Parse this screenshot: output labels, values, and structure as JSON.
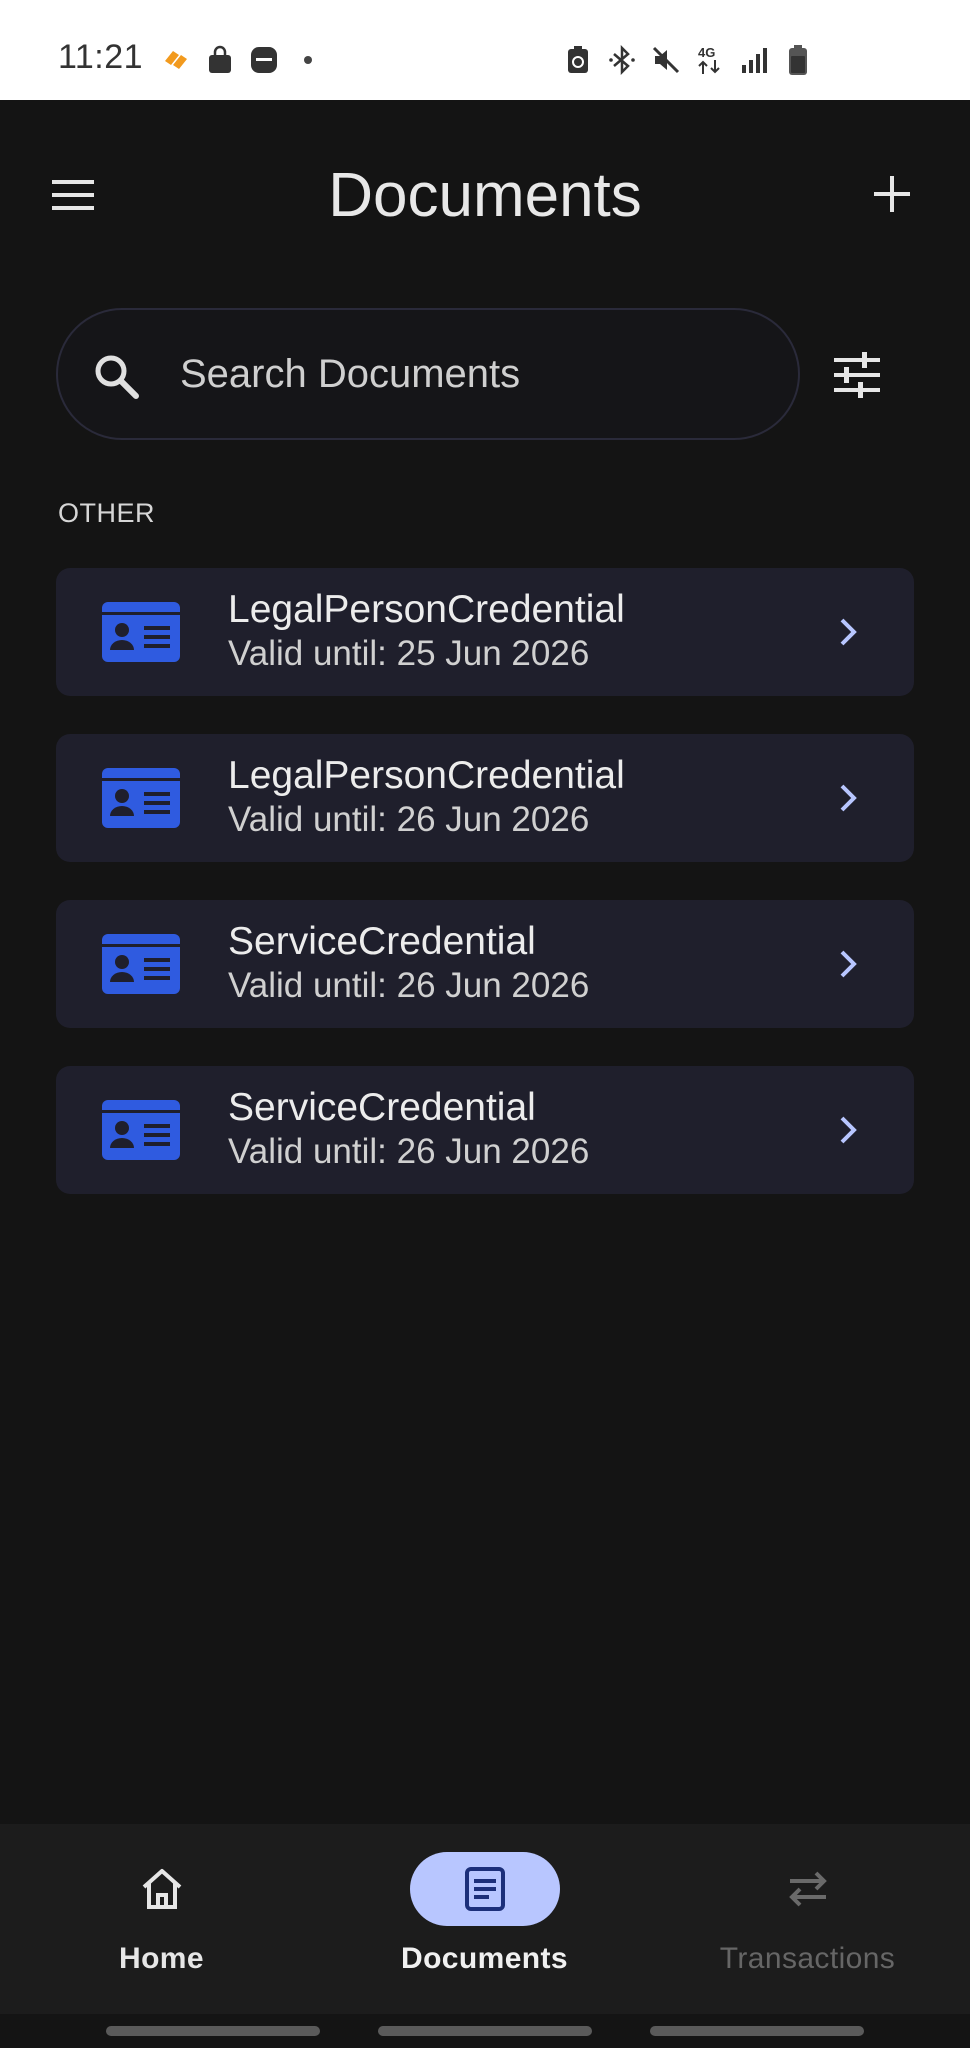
{
  "status_bar": {
    "time": "11:21",
    "left_icons": [
      "app-notification-icon",
      "shopping-bag-icon",
      "news-icon",
      "dot-icon"
    ],
    "right_icons": [
      "battery-saver-icon",
      "bluetooth-icon",
      "mute-icon",
      "network-4g-icon",
      "signal-icon",
      "battery-icon"
    ],
    "network_label": "4G"
  },
  "header": {
    "title": "Documents",
    "menu_icon": "hamburger-menu-icon",
    "add_icon": "plus-icon"
  },
  "search": {
    "placeholder": "Search Documents",
    "value": "",
    "filter_icon": "tune-icon"
  },
  "section": {
    "label": "OTHER"
  },
  "documents": [
    {
      "title": "LegalPersonCredential",
      "subtitle": "Valid until: 25 Jun 2026"
    },
    {
      "title": "LegalPersonCredential",
      "subtitle": "Valid until: 26 Jun 2026"
    },
    {
      "title": "ServiceCredential",
      "subtitle": "Valid until: 26 Jun 2026"
    },
    {
      "title": "ServiceCredential",
      "subtitle": "Valid until: 26 Jun 2026"
    }
  ],
  "bottom_nav": {
    "items": [
      {
        "label": "Home",
        "icon": "home-icon",
        "active": false,
        "disabled": false
      },
      {
        "label": "Documents",
        "icon": "document-icon",
        "active": true,
        "disabled": false
      },
      {
        "label": "Transactions",
        "icon": "swap-arrows-icon",
        "active": false,
        "disabled": true
      }
    ]
  },
  "colors": {
    "background": "#141414",
    "card": "#1f1f2c",
    "accent": "#2f5be0",
    "chevron": "#b8c6ff",
    "nav_active_pill": "#b8c6ff",
    "nav_active_icon": "#1c2f7a"
  }
}
